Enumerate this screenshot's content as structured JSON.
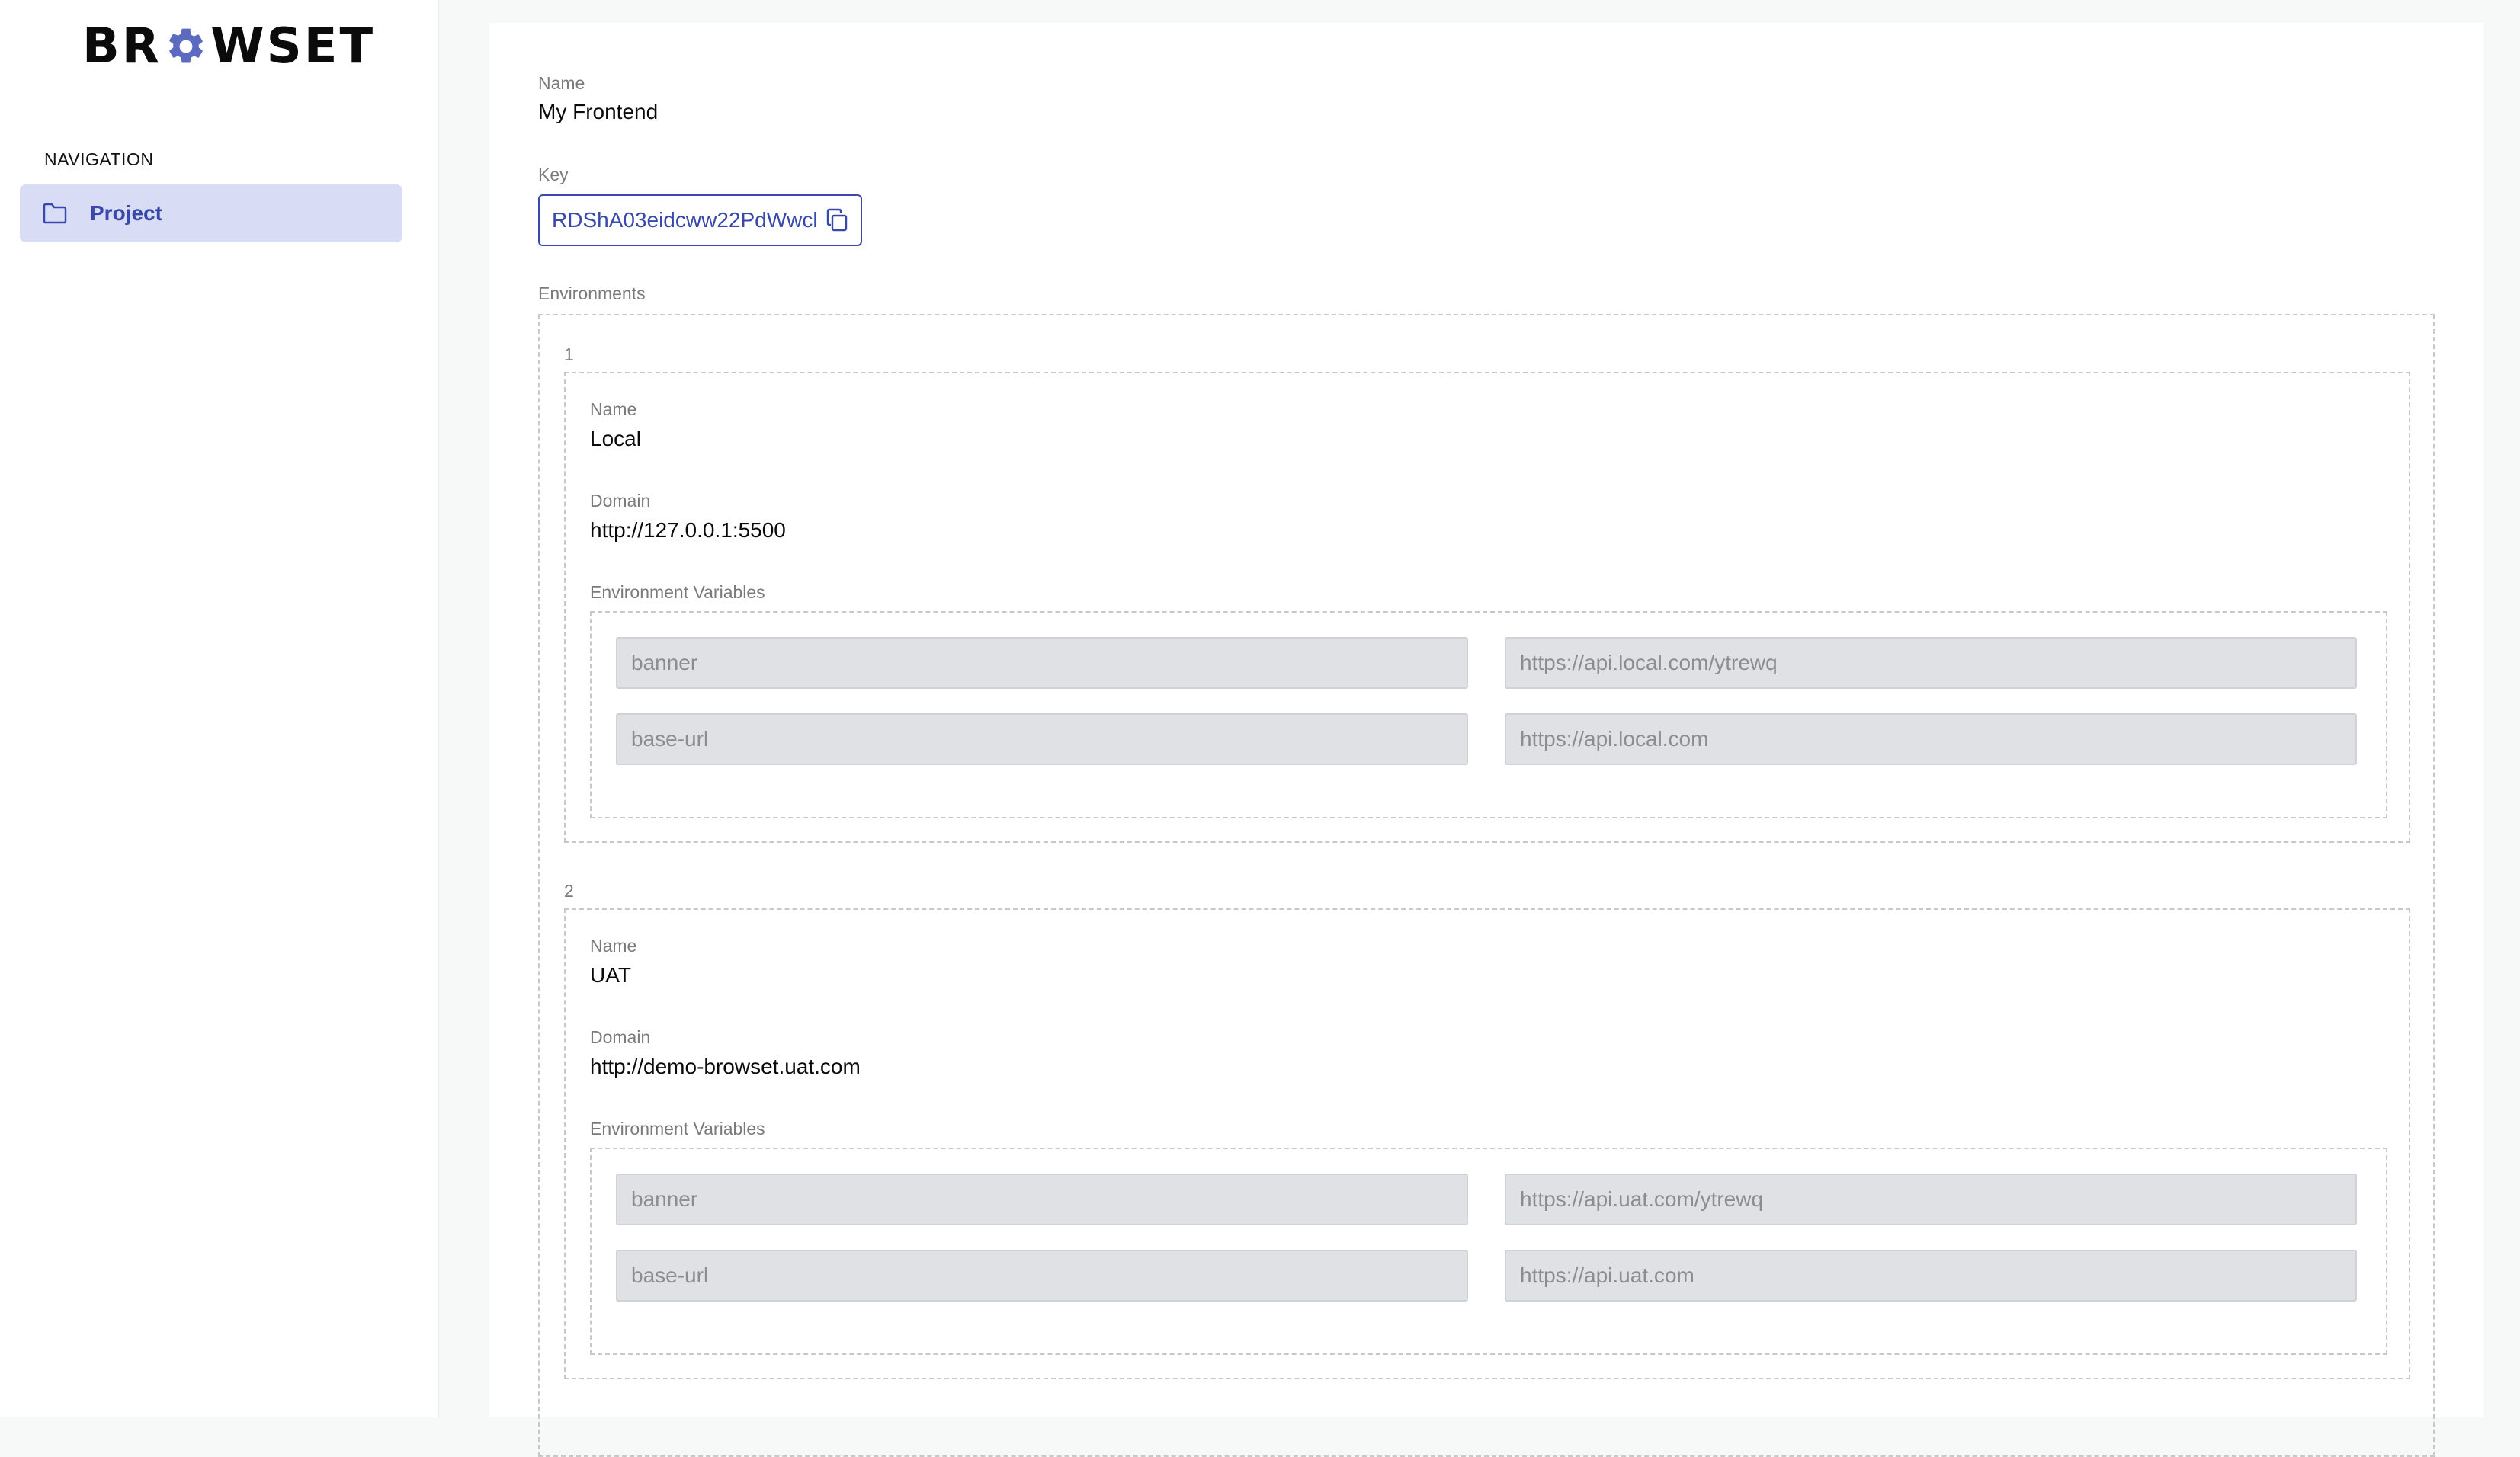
{
  "brand": {
    "logo_left": "BR",
    "logo_right": "WSET"
  },
  "nav": {
    "heading": "NAVIGATION",
    "items": [
      {
        "label": "Project",
        "icon": "folder-icon"
      }
    ]
  },
  "project": {
    "name_label": "Name",
    "name": "My Frontend",
    "key_label": "Key",
    "key": "RDShA03eidcww22PdWwcl",
    "environments_label": "Environments",
    "environments": [
      {
        "index": "1",
        "name_label": "Name",
        "name": "Local",
        "domain_label": "Domain",
        "domain": "http://127.0.0.1:5500",
        "vars_label": "Environment Variables",
        "vars": [
          {
            "key": "banner",
            "value": "https://api.local.com/ytrewq"
          },
          {
            "key": "base-url",
            "value": "https://api.local.com"
          }
        ]
      },
      {
        "index": "2",
        "name_label": "Name",
        "name": "UAT",
        "domain_label": "Domain",
        "domain": "http://demo-browset.uat.com",
        "vars_label": "Environment Variables",
        "vars": [
          {
            "key": "banner",
            "value": "https://api.uat.com/ytrewq"
          },
          {
            "key": "base-url",
            "value": "https://api.uat.com"
          }
        ]
      }
    ]
  },
  "colors": {
    "accent": "#3949ab",
    "nav_active_bg": "#d8dcf4",
    "input_bg": "#dfe1e4"
  }
}
